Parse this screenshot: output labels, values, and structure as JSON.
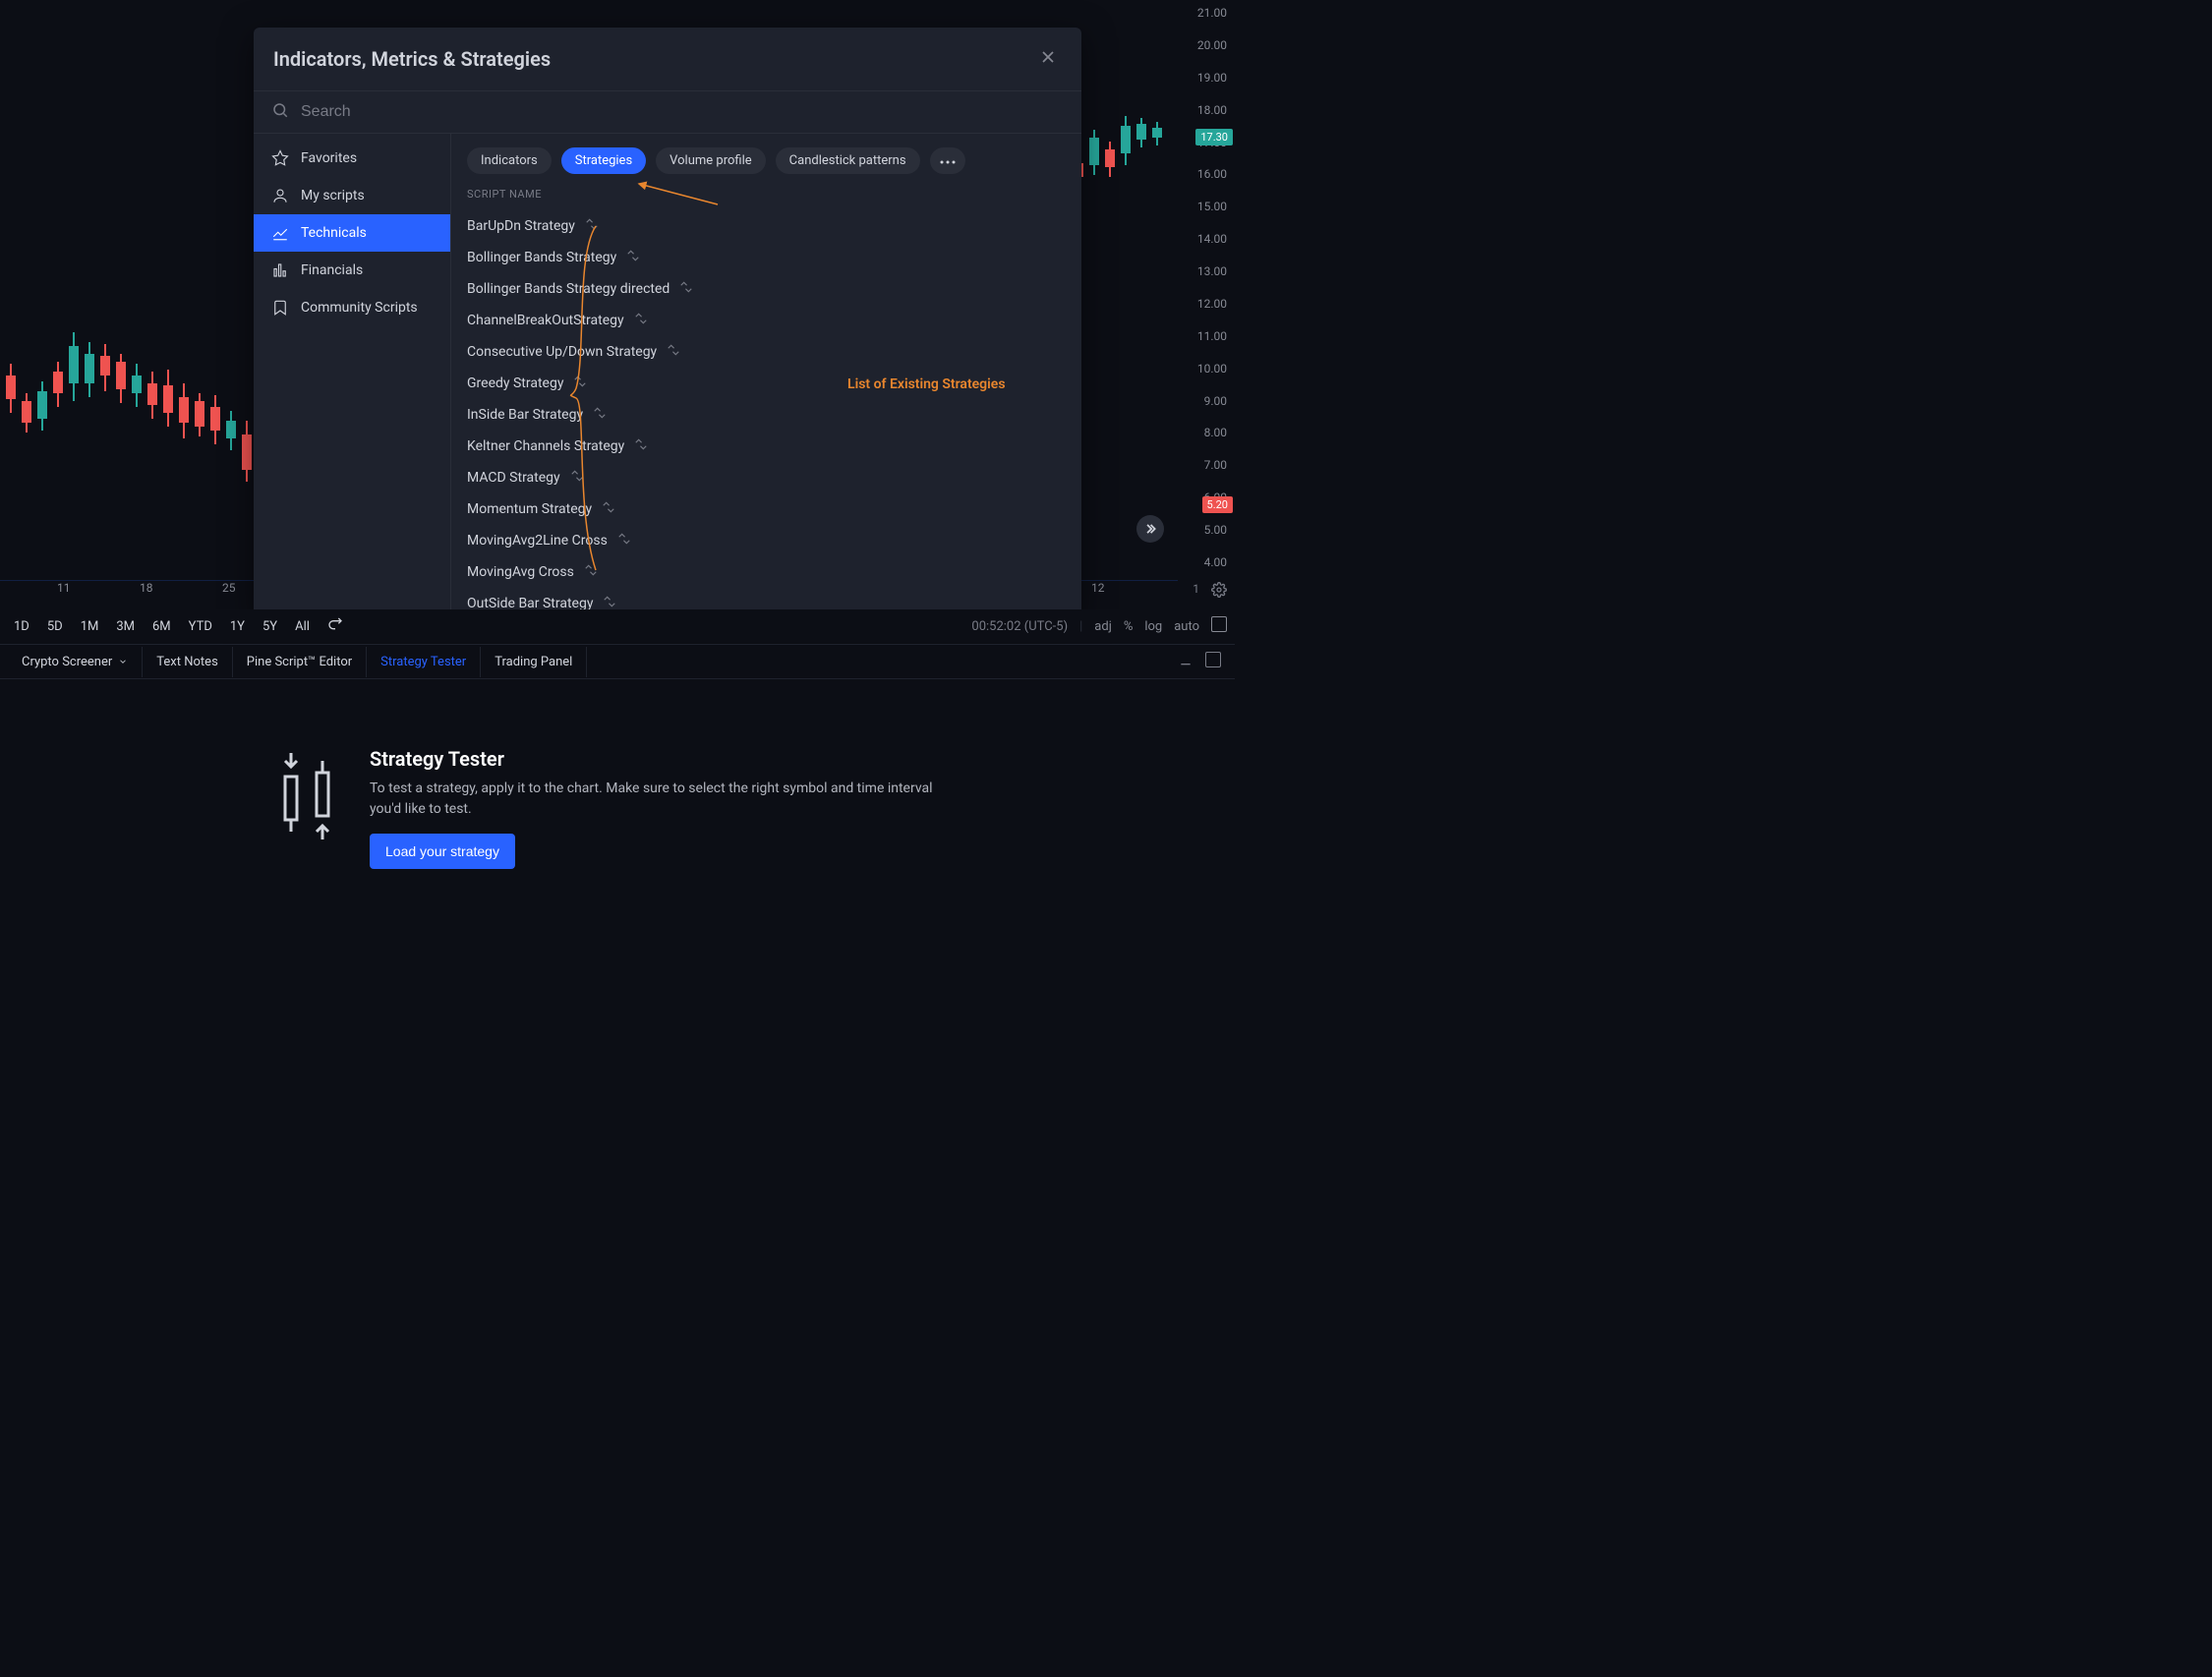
{
  "modal": {
    "title": "Indicators, Metrics & Strategies",
    "search_placeholder": "Search",
    "nav": {
      "favorites": "Favorites",
      "my_scripts": "My scripts",
      "technicals": "Technicals",
      "financials": "Financials",
      "community": "Community Scripts"
    },
    "pills": {
      "indicators": "Indicators",
      "strategies": "Strategies",
      "volume_profile": "Volume profile",
      "candlestick": "Candlestick patterns"
    },
    "section_label": "SCRIPT NAME",
    "scripts": [
      "BarUpDn Strategy",
      "Bollinger Bands Strategy",
      "Bollinger Bands Strategy directed",
      "ChannelBreakOutStrategy",
      "Consecutive Up/Down Strategy",
      "Greedy Strategy",
      "InSide Bar Strategy",
      "Keltner Channels Strategy",
      "MACD Strategy",
      "Momentum Strategy",
      "MovingAvg2Line Cross",
      "MovingAvg Cross",
      "OutSide Bar Strategy"
    ]
  },
  "annotation": {
    "label": "List of Existing Strategies"
  },
  "price_axis": [
    "21.00",
    "20.00",
    "19.00",
    "18.00",
    "17.00",
    "16.00",
    "15.00",
    "14.00",
    "13.00",
    "12.00",
    "11.00",
    "10.00",
    "9.00",
    "8.00",
    "7.00",
    "6.00",
    "5.00",
    "4.00"
  ],
  "price_tags": {
    "green": "17.30",
    "red": "5.20"
  },
  "time_axis": {
    "t0": "11",
    "t1": "18",
    "t2": "25",
    "t3": "12"
  },
  "intervals": {
    "d1": "1D",
    "d5": "5D",
    "m1": "1M",
    "m3": "3M",
    "m6": "6M",
    "ytd": "YTD",
    "y1": "1Y",
    "y5": "5Y",
    "all": "All"
  },
  "right_controls": {
    "clock": "00:52:02 (UTC-5)",
    "adj": "adj",
    "pct": "%",
    "log": "log",
    "auto": "auto"
  },
  "bottom_tabs": {
    "crypto": "Crypto Screener",
    "notes": "Text Notes",
    "pine": "Pine Script™ Editor",
    "strategy": "Strategy Tester",
    "trading": "Trading Panel"
  },
  "strategy_panel": {
    "title": "Strategy Tester",
    "desc": "To test a strategy, apply it to the chart. Make sure to select the right symbol and time interval you'd like to test.",
    "button": "Load your strategy"
  },
  "axis_extra": {
    "one": "1"
  }
}
